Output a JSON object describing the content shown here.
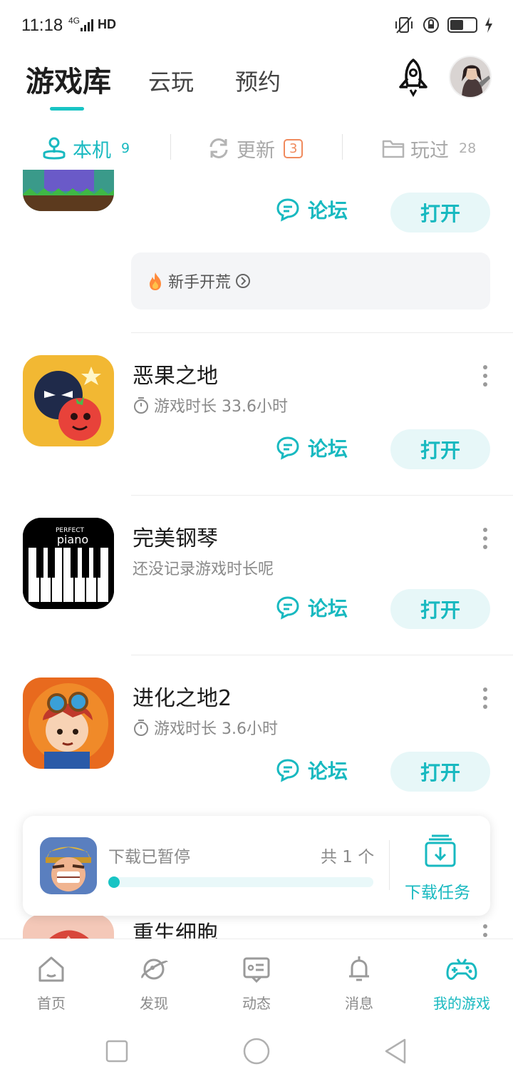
{
  "status_bar": {
    "time": "11:18",
    "network": "4G",
    "hd": "HD"
  },
  "header": {
    "tabs": [
      {
        "label": "游戏库"
      },
      {
        "label": "云玩"
      },
      {
        "label": "预约"
      }
    ]
  },
  "subtabs": {
    "local": {
      "label": "本机",
      "count": "9"
    },
    "update": {
      "label": "更新",
      "count": "3"
    },
    "played": {
      "label": "玩过",
      "count": "28"
    }
  },
  "games": [
    {
      "title": "",
      "tag": "新手开荒",
      "forum_label": "论坛",
      "open_label": "打开"
    },
    {
      "title": "恶果之地",
      "meta": "游戏时长 33.6小时",
      "forum_label": "论坛",
      "open_label": "打开"
    },
    {
      "title": "完美钢琴",
      "meta": "还没记录游戏时长呢",
      "forum_label": "论坛",
      "open_label": "打开",
      "icon_text": "PERFECT",
      "icon_text2": "piano"
    },
    {
      "title": "进化之地2",
      "meta": "游戏时长 3.6小时",
      "forum_label": "论坛",
      "open_label": "打开"
    },
    {
      "title": "重生细胞"
    }
  ],
  "download": {
    "status": "下载已暂停",
    "count": "共 1 个",
    "task_label": "下载任务",
    "progress": 0.04
  },
  "bottom_nav": [
    {
      "label": "首页",
      "icon": "home-icon"
    },
    {
      "label": "发现",
      "icon": "planet-icon"
    },
    {
      "label": "动态",
      "icon": "feed-icon"
    },
    {
      "label": "消息",
      "icon": "bell-icon"
    },
    {
      "label": "我的游戏",
      "icon": "gamepad-icon"
    }
  ],
  "colors": {
    "accent": "#18c4c4",
    "accent_text": "#18b9c0",
    "badge": "#f08a5d"
  }
}
